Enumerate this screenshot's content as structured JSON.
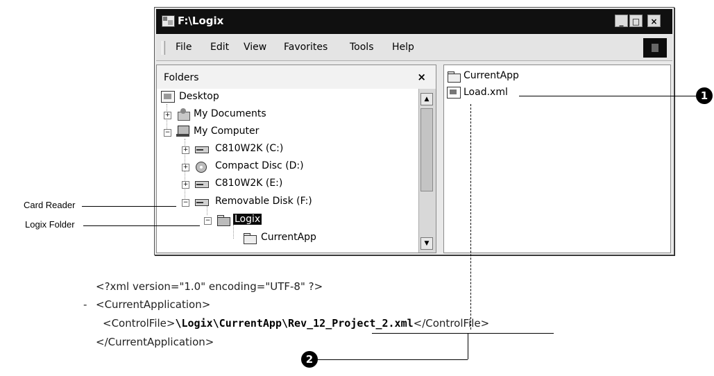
{
  "window": {
    "title": "F:\\Logix",
    "buttons": {
      "minimize": "_",
      "maximize": "□",
      "close": "×"
    }
  },
  "menu": {
    "items": [
      "File",
      "Edit",
      "View",
      "Favorites",
      "Tools",
      "Help"
    ]
  },
  "folders_pane": {
    "title": "Folders",
    "close": "×",
    "tree": [
      {
        "label": "Desktop",
        "icon": "desktop-icon"
      },
      {
        "label": "My Documents",
        "icon": "my-documents-icon",
        "expander": "+"
      },
      {
        "label": "My Computer",
        "icon": "my-computer-icon",
        "expander": "−"
      },
      {
        "label": "C810W2K (C:)",
        "icon": "drive-icon",
        "expander": "+"
      },
      {
        "label": "Compact Disc (D:)",
        "icon": "cd-drive-icon",
        "expander": "+"
      },
      {
        "label": "C810W2K (E:)",
        "icon": "drive-icon",
        "expander": "+"
      },
      {
        "label": "Removable Disk (F:)",
        "icon": "removable-disk-icon",
        "expander": "−"
      },
      {
        "label": "Logix",
        "icon": "open-folder-icon",
        "expander": "−",
        "selected": true
      },
      {
        "label": "CurrentApp",
        "icon": "folder-icon"
      }
    ]
  },
  "contents_pane": {
    "items": [
      {
        "label": "CurrentApp",
        "icon": "folder-icon"
      },
      {
        "label": "Load.xml",
        "icon": "xml-file-icon"
      }
    ]
  },
  "callouts": {
    "card_reader": "Card Reader",
    "logix_folder": "Logix Folder",
    "bubble_1": "1",
    "bubble_2": "2"
  },
  "xml": {
    "line1": "<?xml version=\"1.0\" encoding=\"UTF-8\" ?>",
    "line2_dash": "-",
    "line2": "<CurrentApplication>",
    "line3_open": "<ControlFile>",
    "line3_path": "\\Logix\\CurrentApp\\",
    "line3_file": "Rev_12_Project_2.xml",
    "line3_close": "</ControlFile>",
    "line4": "</CurrentApplication>"
  }
}
